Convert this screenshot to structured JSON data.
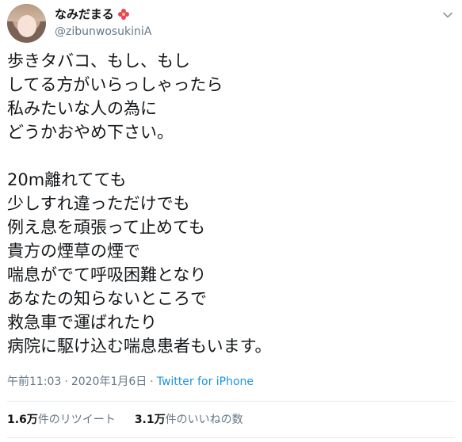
{
  "user": {
    "display_name": "なみだまる",
    "handle": "@zibunwosukiniA",
    "avatar_icon": "avatar-photo",
    "name_emoji_icon": "flower-icon"
  },
  "tweet": {
    "text": "歩きタバコ、もし、もし\nしてる方がいらっしゃったら\n私みたいな人の為に\nどうかおやめ下さい。\n\n20m離れてても\n少しすれ違っただけでも\n例え息を頑張って止めても\n貴方の煙草の煙で\n喘息がでて呼吸困難となり\nあなたの知らないところで\n救急車で運ばれたり\n病院に駆け込む喘息患者もいます。",
    "time": "午前11:03",
    "separator": "·",
    "date": "2020年1月6日",
    "source": "Twitter for iPhone"
  },
  "stats": {
    "retweets_count": "1.6万",
    "retweets_label": "件のリツイート",
    "likes_count": "3.1万",
    "likes_label": "件のいいねの数"
  },
  "colors": {
    "text": "#14171a",
    "secondary": "#657786",
    "link": "#1b95e0",
    "divider": "#e6ecf0"
  }
}
